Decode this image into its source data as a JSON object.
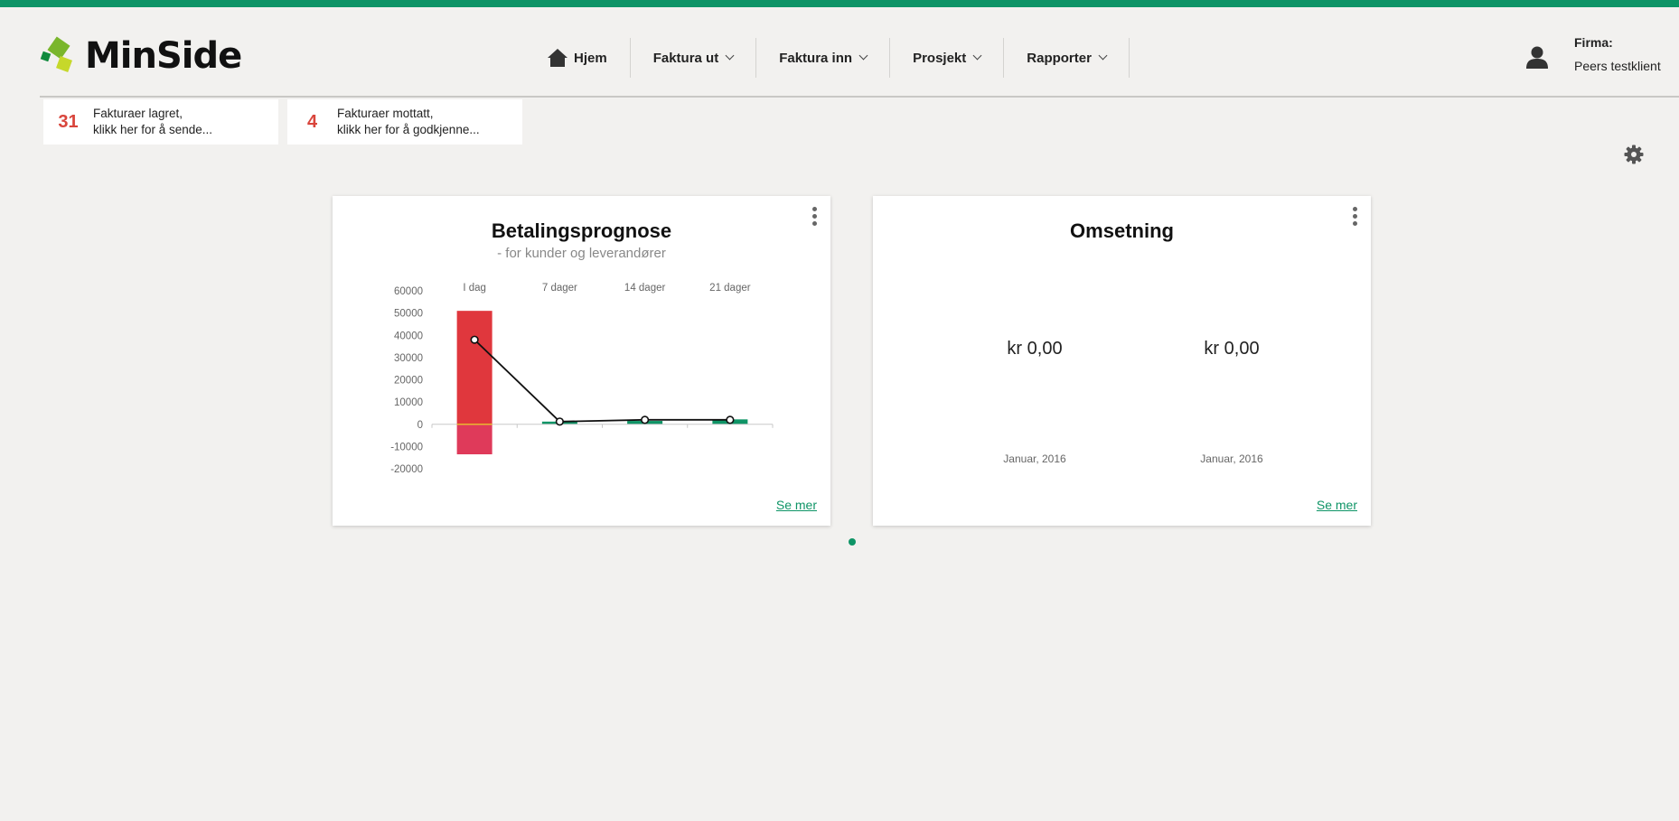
{
  "brand": {
    "name": "MinSide",
    "accent": "#0e9466",
    "alert": "#d9453c"
  },
  "nav": {
    "items": [
      {
        "label": "Hjem",
        "icon": "home-icon"
      },
      {
        "label": "Faktura ut",
        "icon": "chevron-down-icon"
      },
      {
        "label": "Faktura inn",
        "icon": "chevron-down-icon"
      },
      {
        "label": "Prosjekt",
        "icon": "chevron-down-icon"
      },
      {
        "label": "Rapporter",
        "icon": "chevron-down-icon"
      }
    ]
  },
  "user": {
    "icon": "user-icon",
    "firma_label": "Firma:",
    "firma_name": "Peers testklient"
  },
  "notifications": [
    {
      "count": "31",
      "line1": "Fakturaer lagret,",
      "line2": "klikk her for å sende..."
    },
    {
      "count": "4",
      "line1": "Fakturaer mottatt,",
      "line2": "klikk her for å godkjenne..."
    }
  ],
  "settings": {
    "icon": "gear-icon"
  },
  "widgets": {
    "betaling": {
      "title": "Betalingsprognose",
      "subtitle": "- for kunder og leverandører",
      "link": "Se mer"
    },
    "omsetning": {
      "title": "Omsetning",
      "values": [
        {
          "amount": "kr 0,00",
          "period": "Januar, 2016"
        },
        {
          "amount": "kr 0,00",
          "period": "Januar, 2016"
        }
      ],
      "link": "Se mer"
    }
  },
  "chart_data": {
    "type": "bar",
    "categories": [
      "I dag",
      "7 dager",
      "14 dager",
      "21 dager"
    ],
    "series": [
      {
        "kind": "bar",
        "color": "#e0373d",
        "values": [
          51000,
          0,
          0,
          0
        ]
      },
      {
        "kind": "bar",
        "color": "#df3a5a",
        "values": [
          -13500,
          0,
          0,
          0
        ]
      },
      {
        "kind": "bar",
        "color": "#0e9466",
        "values": [
          0,
          1200,
          1500,
          2200
        ]
      },
      {
        "kind": "line",
        "color": "#111111",
        "values": [
          38000,
          1200,
          2000,
          2000
        ]
      }
    ],
    "yticks": [
      60000,
      50000,
      40000,
      30000,
      20000,
      10000,
      0,
      -10000,
      -20000
    ],
    "ylim": [
      -20000,
      60000
    ],
    "grid": false
  }
}
